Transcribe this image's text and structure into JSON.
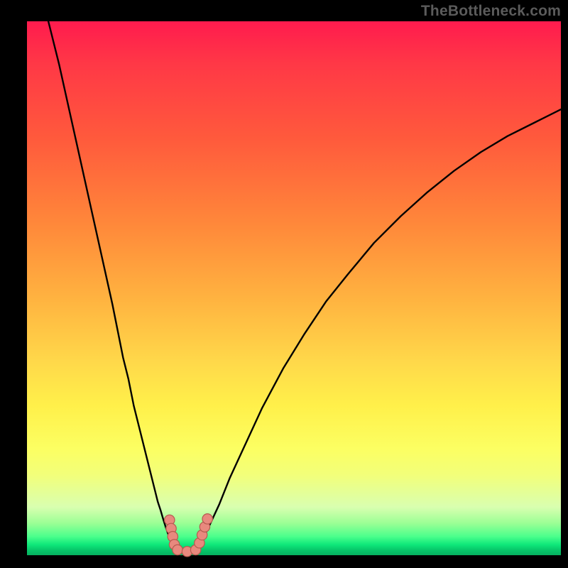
{
  "watermark": {
    "text": "TheBottleneck.com"
  },
  "chart_data": {
    "type": "line",
    "title": "",
    "xlabel": "",
    "ylabel": "",
    "xlim": [
      0,
      100
    ],
    "ylim": [
      0,
      100
    ],
    "series": [
      {
        "name": "left-curve",
        "x": [
          4,
          6,
          8,
          10,
          12,
          14,
          16,
          17,
          18,
          19,
          20,
          21,
          22,
          23,
          24,
          24.5,
          25,
          25.5,
          26,
          26.5,
          27,
          27.5
        ],
        "y": [
          100,
          92,
          83,
          74,
          65,
          56,
          47,
          42,
          37,
          33,
          28,
          24,
          20,
          16,
          12,
          10,
          8.5,
          6.8,
          5.2,
          3.8,
          2.5,
          1.2
        ]
      },
      {
        "name": "right-curve",
        "x": [
          32,
          33,
          34,
          36,
          38,
          41,
          44,
          48,
          52,
          56,
          60,
          65,
          70,
          75,
          80,
          85,
          90,
          95,
          100
        ],
        "y": [
          1.5,
          3.2,
          5.2,
          9.5,
          14.5,
          21,
          27.5,
          35,
          41.5,
          47.5,
          52.5,
          58.5,
          63.5,
          68,
          72,
          75.5,
          78.5,
          81,
          83.5
        ]
      },
      {
        "name": "valley-floor",
        "x": [
          27.5,
          28,
          29,
          30,
          31,
          32
        ],
        "y": [
          1.2,
          0.8,
          0.6,
          0.6,
          0.8,
          1.5
        ]
      }
    ],
    "markers": [
      {
        "name": "left-dot-upper",
        "x": 26.7,
        "y": 6.6
      },
      {
        "name": "left-dot-mid1",
        "x": 27.0,
        "y": 5.0
      },
      {
        "name": "left-dot-mid2",
        "x": 27.3,
        "y": 3.5
      },
      {
        "name": "left-dot-low",
        "x": 27.6,
        "y": 2.0
      },
      {
        "name": "floor-dot-1",
        "x": 28.2,
        "y": 1.0
      },
      {
        "name": "floor-dot-2",
        "x": 30.0,
        "y": 0.7
      },
      {
        "name": "floor-dot-3",
        "x": 31.6,
        "y": 1.0
      },
      {
        "name": "right-dot-low",
        "x": 32.3,
        "y": 2.3
      },
      {
        "name": "right-dot-mid1",
        "x": 32.8,
        "y": 3.8
      },
      {
        "name": "right-dot-mid2",
        "x": 33.3,
        "y": 5.3
      },
      {
        "name": "right-dot-upper",
        "x": 33.8,
        "y": 6.8
      }
    ],
    "colors": {
      "curve": "#000000",
      "marker_fill": "#e8897e",
      "marker_stroke": "#b55a4f",
      "gradient_top": "#ff1b4e",
      "gradient_bottom": "#06b060"
    }
  }
}
